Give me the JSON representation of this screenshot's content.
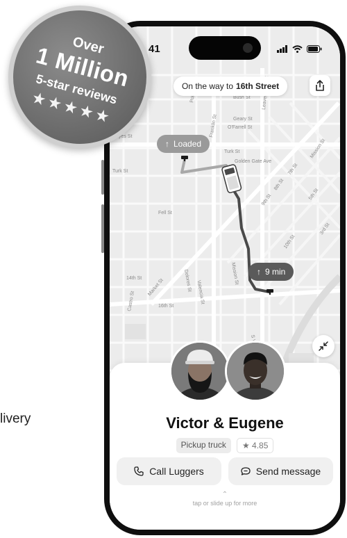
{
  "left_caption": "livery",
  "status_bar": {
    "time": "41"
  },
  "map": {
    "destination_prefix": "On the way to",
    "destination": "16th Street",
    "loaded_label": "Loaded",
    "eta_label": "9 min",
    "street_labels": [
      "Bush St",
      "Geary St",
      "O'Farrell St",
      "Turk St",
      "Golden Gate Ave",
      "Turk St",
      "Fell St",
      "14th St",
      "Market St",
      "16th St",
      "Castro St",
      "Valencia St",
      "Mission St",
      "Dolores St",
      "7th St",
      "8th St",
      "9th St",
      "10th St",
      "Mission St",
      "Franklin St",
      "Leavenworth St",
      "S Van Ness",
      "Hayes St",
      "Polk St",
      "5th St",
      "3rd St"
    ]
  },
  "driver_card": {
    "names": "Victor & Eugene",
    "vehicle": "Pickup truck",
    "rating": "4.85",
    "call_label": "Call Luggers",
    "message_label": "Send message",
    "more_hint": "tap or slide up for more"
  },
  "badge": {
    "over": "Over",
    "million": "1 Million",
    "reviews": "5-star reviews",
    "stars": "★★★★★"
  },
  "icons": {
    "signal": "signal-icon",
    "wifi": "wifi-icon",
    "battery": "battery-icon",
    "share": "share-icon",
    "phone": "phone-icon",
    "message": "message-icon",
    "collapse": "collapse-icon"
  }
}
